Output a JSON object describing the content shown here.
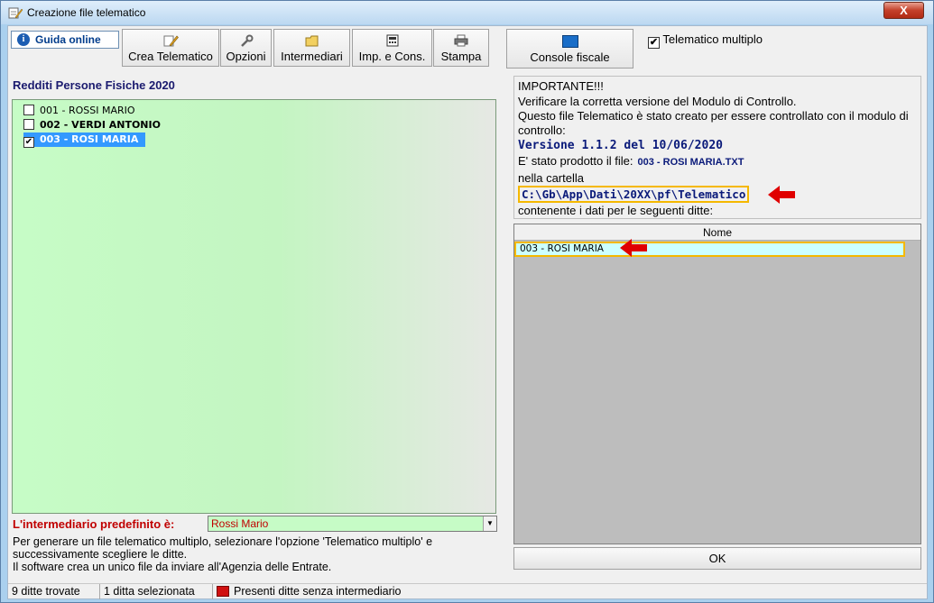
{
  "window": {
    "title": "Creazione file telematico",
    "close_label": "X"
  },
  "toolbar": {
    "guida_online": "Guida online",
    "crea_telematico": "Crea Telematico",
    "opzioni": "Opzioni",
    "intermediari": "Intermediari",
    "imp_cons": "Imp. e Cons.",
    "stampa": "Stampa",
    "console_fiscale": "Console fiscale",
    "telematico_multiplo_label": "Telematico multiplo",
    "telematico_multiplo_checked": true
  },
  "left_panel": {
    "section_title": "Redditi Persone Fisiche 2020",
    "items": [
      {
        "label": "001 - ROSSI MARIO",
        "checked": false,
        "selected": false,
        "bold": false
      },
      {
        "label": "002 - VERDI ANTONIO",
        "checked": false,
        "selected": false,
        "bold": true
      },
      {
        "label": "003 - ROSI MARIA",
        "checked": true,
        "selected": true,
        "bold": true
      }
    ],
    "intermediario_label": "L'intermediario predefinito è:",
    "intermediario_value": "Rossi Mario",
    "help_text": "Per generare un file telematico multiplo, selezionare l'opzione 'Telematico multiplo' e successivamente scegliere le ditte.\nIl software crea un unico file da inviare all'Agenzia delle Entrate."
  },
  "info": {
    "important": "IMPORTANTE!!!",
    "verify": "Verificare la corretta versione del Modulo di Controllo.",
    "created_for": "Questo file Telematico è stato creato per essere controllato con il modulo di controllo:",
    "version": "Versione 1.1.2 del 10/06/2020",
    "produced_label": "E' stato prodotto il file:",
    "produced_file": "003 - ROSI MARIA.TXT",
    "folder_label": "nella cartella",
    "folder_path": "C:\\Gb\\App\\Dati\\20XX\\pf\\Telematico",
    "containing": "contenente i dati per le seguenti ditte:"
  },
  "grid": {
    "column_header": "Nome",
    "rows": [
      "003 - ROSI MARIA"
    ]
  },
  "ok_button": "OK",
  "status": {
    "found": "9 ditte trovate",
    "selected": "1 ditta selezionata",
    "warning": "Presenti ditte senza intermediario"
  },
  "colors": {
    "list_background": "#c6fcc6",
    "selection": "#3399ff",
    "highlight_border": "#f5b800",
    "annotation_arrow": "#e00000",
    "label_red": "#c00000"
  }
}
